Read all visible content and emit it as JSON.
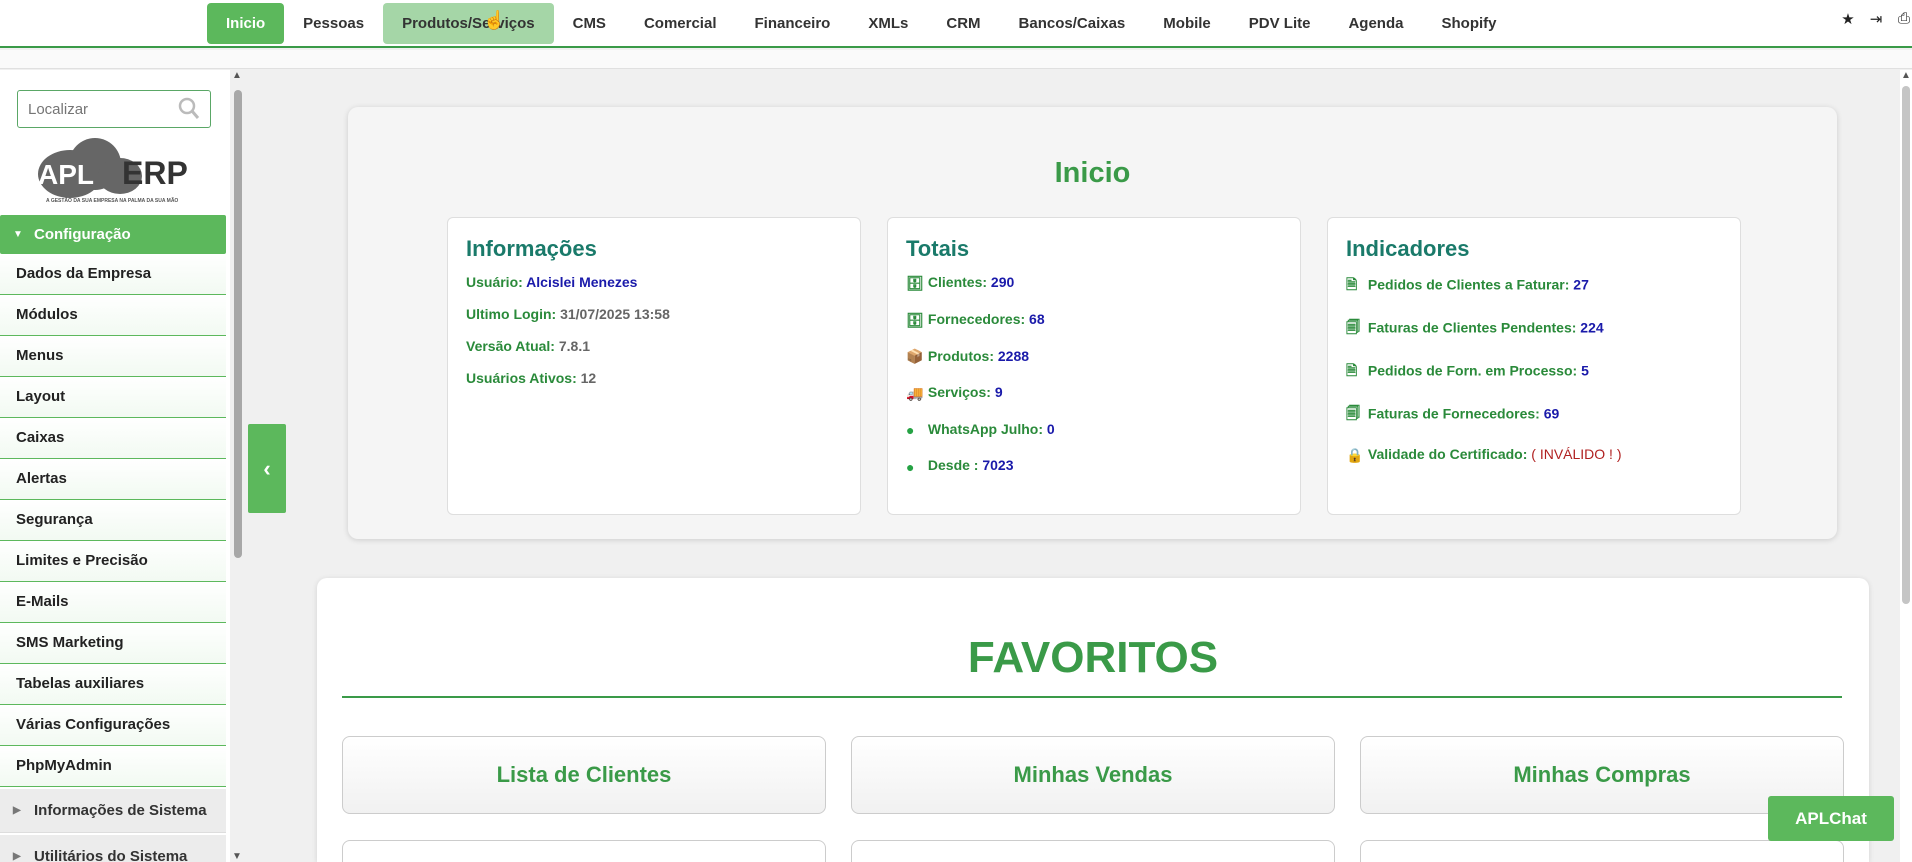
{
  "topnav": {
    "items": [
      "Inicio",
      "Pessoas",
      "Produtos/Serviços",
      "CMS",
      "Comercial",
      "Financeiro",
      "XMLs",
      "CRM",
      "Bancos/Caixas",
      "Mobile",
      "PDV Lite",
      "Agenda",
      "Shopify"
    ],
    "active": "Inicio",
    "hovered": "Produtos/Serviços",
    "tools": [
      "star-icon",
      "logout-icon",
      "print-icon"
    ]
  },
  "sidebar": {
    "search_placeholder": "Localizar",
    "logo_text": "APL ERP",
    "logo_tagline": "A GESTÃO DA SUA EMPRESA NA PALMA DA SUA MÃO",
    "section_label": "Configuração",
    "items": [
      "Dados da Empresa",
      "Módulos",
      "Menus",
      "Layout",
      "Caixas",
      "Alertas",
      "Segurança",
      "Limites e Precisão",
      "E-Mails",
      "SMS Marketing",
      "Tabelas auxiliares",
      "Várias Configurações",
      "PhpMyAdmin"
    ],
    "collapsed_sections": [
      "Informações de Sistema",
      "Utilitários do Sistema"
    ]
  },
  "inicio": {
    "title": "Inicio",
    "info": {
      "heading": "Informações",
      "usuario_label": "Usuário:",
      "usuario_value": "Alcislei Menezes",
      "login_label": "Ultimo Login:",
      "login_value": "31/07/2025 13:58",
      "versao_label": "Versão Atual:",
      "versao_value": "7.8.1",
      "ativos_label": "Usuários Ativos:",
      "ativos_value": "12"
    },
    "totais": {
      "heading": "Totais",
      "rows": [
        {
          "label": "Clientes:",
          "value": "290",
          "icon": "database-icon"
        },
        {
          "label": "Fornecedores:",
          "value": "68",
          "icon": "database-icon"
        },
        {
          "label": "Produtos:",
          "value": "2288",
          "icon": "box-icon"
        },
        {
          "label": "Serviços:",
          "value": "9",
          "icon": "truck-icon"
        },
        {
          "label": "WhatsApp Julho:",
          "value": "0",
          "icon": "whatsapp-icon"
        },
        {
          "label": "Desde :",
          "value": "7023",
          "icon": "whatsapp-icon"
        }
      ]
    },
    "indicadores": {
      "heading": "Indicadores",
      "rows": [
        {
          "label": "Pedidos de Clientes a Faturar:",
          "value": "27",
          "icon": "document-icon"
        },
        {
          "label": "Faturas de Clientes Pendentes:",
          "value": "224",
          "icon": "invoice-icon"
        },
        {
          "label": "Pedidos de Forn. em Processo:",
          "value": "5",
          "icon": "document-icon"
        },
        {
          "label": "Faturas de Fornecedores:",
          "value": "69",
          "icon": "invoice-icon"
        },
        {
          "label": "Validade do Certificado:",
          "value": "( INVÁLIDO ! )",
          "icon": "lock-icon"
        }
      ]
    }
  },
  "favoritos": {
    "title": "FAVORITOS",
    "buttons": [
      "Lista de Clientes",
      "Minhas Vendas",
      "Minhas Compras"
    ]
  },
  "chat": {
    "label": "APLChat"
  },
  "colors": {
    "accent": "#5cb85c",
    "heading_green": "#3a9a48",
    "teal": "#1a7a6a",
    "value_blue": "#1a1aaa",
    "alert_red": "#b02020"
  }
}
